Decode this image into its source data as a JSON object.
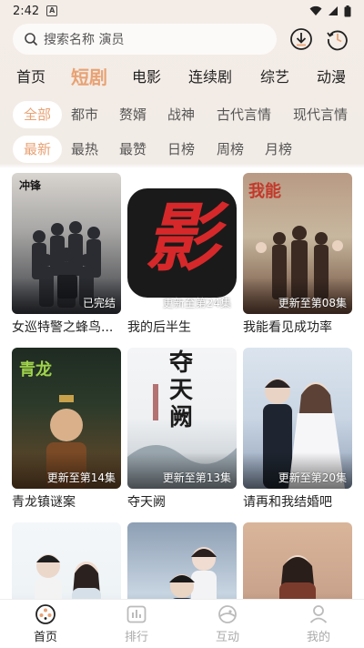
{
  "status_bar": {
    "time": "2:42",
    "notification_badge": "A"
  },
  "search": {
    "placeholder": "搜索名称 演员"
  },
  "categories": [
    {
      "label": "首页"
    },
    {
      "label": "短剧",
      "active": true
    },
    {
      "label": "电影"
    },
    {
      "label": "连续剧"
    },
    {
      "label": "综艺"
    },
    {
      "label": "动漫"
    }
  ],
  "genre_filters": [
    {
      "label": "全部",
      "active": true
    },
    {
      "label": "都市"
    },
    {
      "label": "赘婿"
    },
    {
      "label": "战神"
    },
    {
      "label": "古代言情"
    },
    {
      "label": "现代言情"
    }
  ],
  "sort_filters": [
    {
      "label": "最新",
      "active": true
    },
    {
      "label": "最热"
    },
    {
      "label": "最赞"
    },
    {
      "label": "日榜"
    },
    {
      "label": "周榜"
    },
    {
      "label": "月榜"
    }
  ],
  "shows": [
    {
      "title": "女巡特警之蜂鸟...",
      "status": "已完结",
      "poster_text": "",
      "colors": [
        "#d8d4cf",
        "#3a3c42"
      ]
    },
    {
      "title": "我的后半生",
      "status": "更新至第24集",
      "poster_text": "影",
      "colors": [
        "#ffffff",
        "#1a1a1a"
      ]
    },
    {
      "title": "我能看见成功率",
      "status": "更新至第08集",
      "poster_text": "",
      "colors": [
        "#c7b79e",
        "#6c4b3b"
      ]
    },
    {
      "title": "青龙镇谜案",
      "status": "更新至第14集",
      "poster_text": "",
      "colors": [
        "#2b3a2a",
        "#6b4a2a"
      ]
    },
    {
      "title": "夺天阙",
      "status": "更新至第13集",
      "poster_text": "夺天阙",
      "colors": [
        "#eef0f2",
        "#b9c2c9"
      ]
    },
    {
      "title": "请再和我结婚吧",
      "status": "更新至第20集",
      "poster_text": "",
      "colors": [
        "#c9d5e3",
        "#8fa0b8"
      ]
    },
    {
      "title": "",
      "status": "",
      "poster_text": "",
      "colors": [
        "#eef3f6",
        "#aebfcc"
      ]
    },
    {
      "title": "",
      "status": "",
      "poster_text": "",
      "colors": [
        "#c7d4e1",
        "#6d7d91"
      ]
    },
    {
      "title": "",
      "status": "",
      "poster_text": "",
      "colors": [
        "#caa38c",
        "#6e4b3a"
      ]
    }
  ],
  "bottom_tabs": [
    {
      "label": "首页",
      "icon": "home-reel-icon",
      "active": true
    },
    {
      "label": "排行",
      "icon": "ranking-icon"
    },
    {
      "label": "互动",
      "icon": "interaction-icon"
    },
    {
      "label": "我的",
      "icon": "profile-icon"
    }
  ],
  "colors": {
    "accent": "#e8a274",
    "text": "#222222",
    "muted": "#555555"
  }
}
